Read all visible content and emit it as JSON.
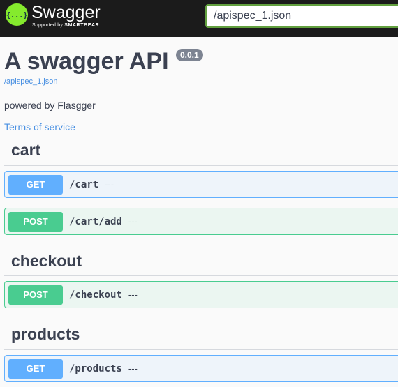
{
  "topbar": {
    "brand": "Swagger",
    "brand_sub_prefix": "Supported by",
    "brand_sub_company": "SMARTBEAR",
    "logo_glyph": "{...}",
    "url_value": "/apispec_1.json"
  },
  "info": {
    "title": "A swagger API",
    "version": "0.0.1",
    "spec_link": "/apispec_1.json",
    "description": "powered by Flasgger",
    "terms_link": "Terms of service"
  },
  "colors": {
    "get": "#61affe",
    "post": "#49cc90",
    "topbar": "#1b1b1b",
    "logo": "#85ea2d",
    "link": "#4990e2"
  },
  "tags": [
    {
      "name": "cart",
      "operations": [
        {
          "method": "GET",
          "path": "/cart",
          "summary": "---"
        },
        {
          "method": "POST",
          "path": "/cart/add",
          "summary": "---"
        }
      ]
    },
    {
      "name": "checkout",
      "operations": [
        {
          "method": "POST",
          "path": "/checkout",
          "summary": "---"
        }
      ]
    },
    {
      "name": "products",
      "operations": [
        {
          "method": "GET",
          "path": "/products",
          "summary": "---"
        }
      ]
    }
  ]
}
